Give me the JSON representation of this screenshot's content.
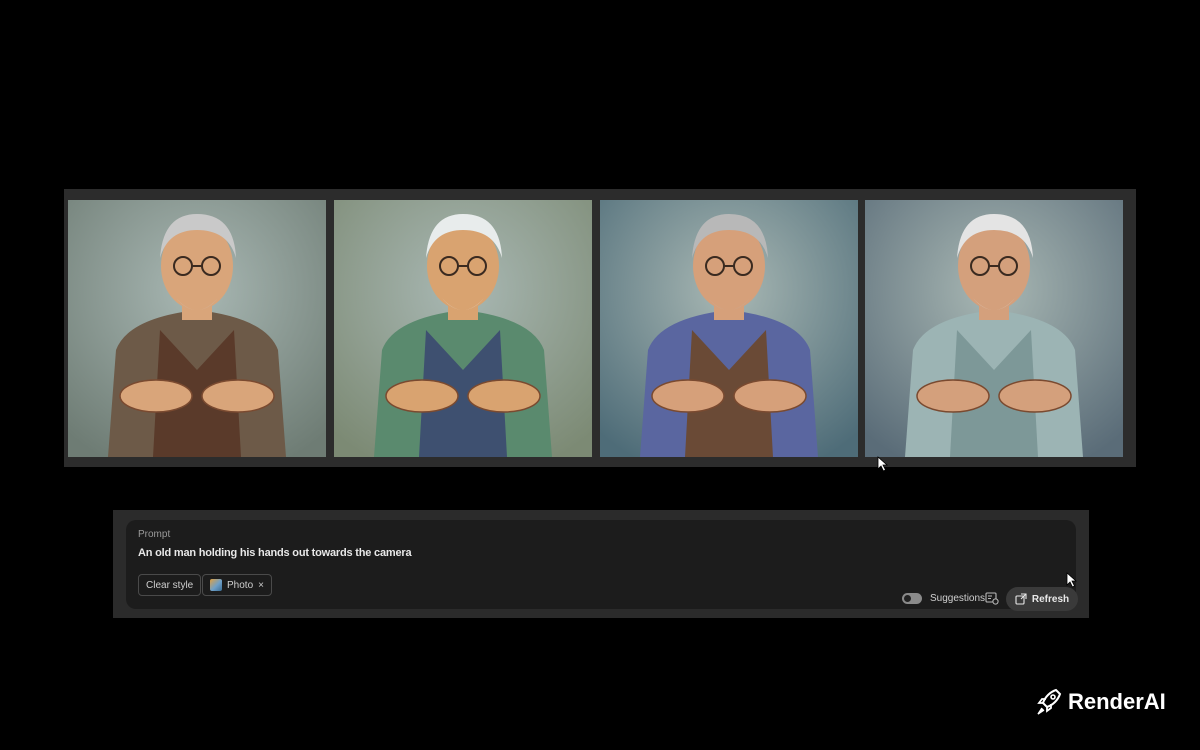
{
  "gallery": {
    "images": [
      {
        "alt": "variation-1",
        "bg": "#6e7c74",
        "skin": "#d9a57a",
        "hair": "#c9c9c9",
        "shirt": "#6d5a48",
        "vest": "#5a3a2a"
      },
      {
        "alt": "variation-2",
        "bg": "#7c8a74",
        "skin": "#d9a370",
        "hair": "#e8ecec",
        "shirt": "#5a8a6e",
        "vest": "#3e5070"
      },
      {
        "alt": "variation-3",
        "bg": "#4e6c78",
        "skin": "#d6a07a",
        "hair": "#b8b8b8",
        "shirt": "#5a66a0",
        "vest": "#6a4a36"
      },
      {
        "alt": "variation-4",
        "bg": "#5a6c78",
        "skin": "#d4a07c",
        "hair": "#e4e4e4",
        "shirt": "#9cb4b4",
        "vest": "#7d9898"
      }
    ]
  },
  "prompt": {
    "label": "Prompt",
    "text": "An old man holding his hands out towards the camera"
  },
  "styles": {
    "clear_label": "Clear style",
    "photo_label": "Photo",
    "photo_remove": "×"
  },
  "controls": {
    "suggestions_label": "Suggestions",
    "suggestions_enabled": true,
    "refresh_label": "Refresh"
  },
  "brand": {
    "name": "RenderAI"
  }
}
